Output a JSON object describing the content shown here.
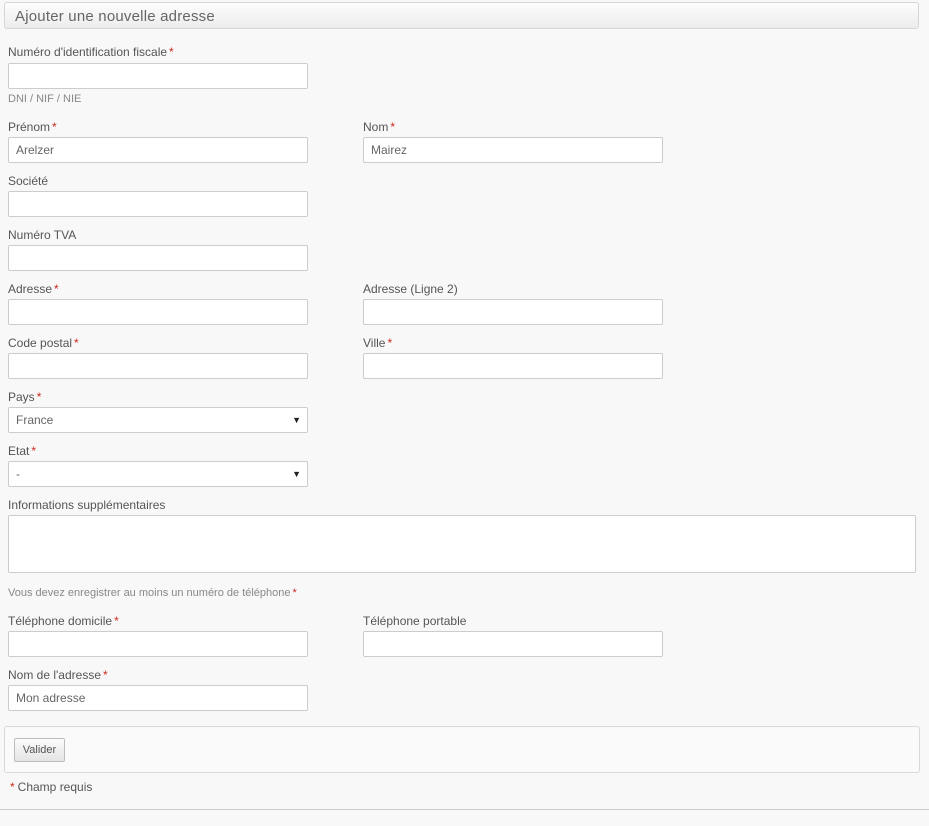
{
  "form_title": "Ajouter une nouvelle adresse",
  "required_mark": "*",
  "fields": {
    "tax_id": {
      "label": "Numéro d'identification fiscale",
      "value": "",
      "hint": "DNI / NIF / NIE"
    },
    "firstname": {
      "label": "Prénom",
      "value": "Arelzer"
    },
    "lastname": {
      "label": "Nom",
      "value": "Mairez"
    },
    "company": {
      "label": "Société",
      "value": ""
    },
    "vat": {
      "label": "Numéro TVA",
      "value": ""
    },
    "address1": {
      "label": "Adresse",
      "value": ""
    },
    "address2": {
      "label": "Adresse (Ligne 2)",
      "value": ""
    },
    "postcode": {
      "label": "Code postal",
      "value": ""
    },
    "city": {
      "label": "Ville",
      "value": ""
    },
    "country": {
      "label": "Pays",
      "value": "France"
    },
    "state": {
      "label": "Etat",
      "value": "-"
    },
    "other": {
      "label": "Informations supplémentaires",
      "value": ""
    },
    "phone": {
      "label": "Téléphone domicile",
      "value": ""
    },
    "phone_mobile": {
      "label": "Téléphone portable",
      "value": ""
    },
    "alias": {
      "label": "Nom de l'adresse",
      "value": "Mon adresse"
    }
  },
  "phone_notice": "Vous devez enregistrer au moins un numéro de téléphone",
  "submit_label": "Valider",
  "required_note": "Champ requis"
}
